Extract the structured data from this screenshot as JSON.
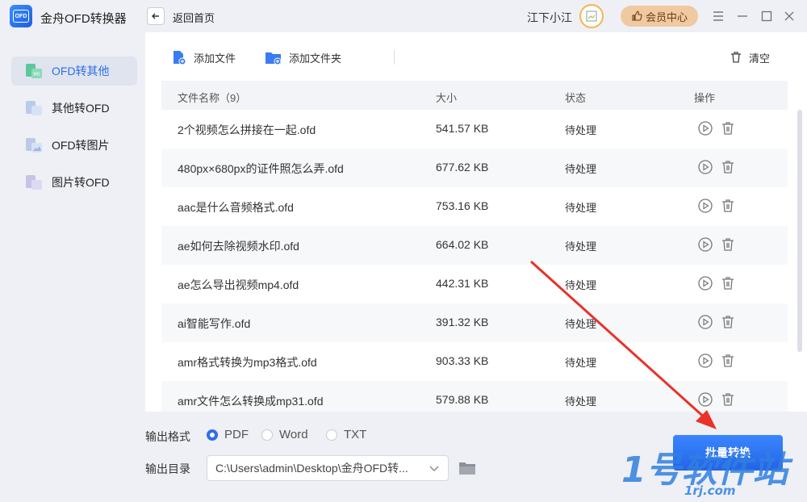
{
  "app": {
    "title": "金舟OFD转换器",
    "logo_text": "OFD",
    "back_label": "返回首页",
    "username": "江下小江",
    "vip_label": "会员中心"
  },
  "sidebar": {
    "items": [
      {
        "label": "OFD转其他",
        "active": true
      },
      {
        "label": "其他转OFD",
        "active": false
      },
      {
        "label": "OFD转图片",
        "active": false
      },
      {
        "label": "图片转OFD",
        "active": false
      }
    ]
  },
  "toolbar": {
    "add_file": "添加文件",
    "add_folder": "添加文件夹",
    "clear": "清空"
  },
  "table": {
    "headers": {
      "name": "文件名称（9）",
      "size": "大小",
      "status": "状态",
      "action": "操作"
    },
    "rows": [
      {
        "name": "2个视频怎么拼接在一起.ofd",
        "size": "541.57 KB",
        "status": "待处理"
      },
      {
        "name": "480px×680px的证件照怎么弄.ofd",
        "size": "677.62 KB",
        "status": "待处理"
      },
      {
        "name": "aac是什么音频格式.ofd",
        "size": "753.16 KB",
        "status": "待处理"
      },
      {
        "name": "ae如何去除视频水印.ofd",
        "size": "664.02 KB",
        "status": "待处理"
      },
      {
        "name": "ae怎么导出视频mp4.ofd",
        "size": "442.31 KB",
        "status": "待处理"
      },
      {
        "name": "ai智能写作.ofd",
        "size": "391.32 KB",
        "status": "待处理"
      },
      {
        "name": "amr格式转换为mp3格式.ofd",
        "size": "903.33 KB",
        "status": "待处理"
      },
      {
        "name": "amr文件怎么转换成mp31.ofd",
        "size": "579.88 KB",
        "status": "待处理"
      }
    ]
  },
  "output": {
    "format_label": "输出格式",
    "formats": [
      {
        "label": "PDF",
        "selected": true
      },
      {
        "label": "Word",
        "selected": false
      },
      {
        "label": "TXT",
        "selected": false
      }
    ],
    "dir_label": "输出目录",
    "dir_value": "C:\\Users\\admin\\Desktop\\金舟OFD转...",
    "convert_label": "批量转换"
  },
  "watermark": {
    "main": "1号软件站",
    "sub": "1rj.com"
  },
  "colors": {
    "accent": "#2f6ee8",
    "arrow": "#e8322a",
    "vip_bg": "#f0c9a0"
  }
}
